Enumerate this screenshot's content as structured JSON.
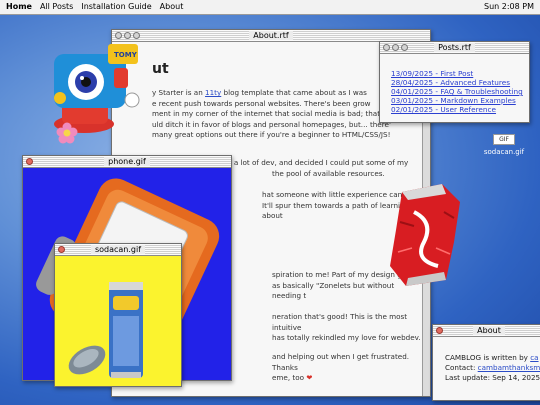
{
  "menubar": {
    "home": "Home",
    "items": [
      "All Posts",
      "Installation Guide",
      "About"
    ],
    "clock": "Sun 2:08 PM"
  },
  "about_window": {
    "title": "About.rtf",
    "heading": "ut",
    "p1_prefix": "y Starter is an ",
    "p1_link": "11ty",
    "p1_rest": " blog template that came about as I was",
    "p1_l2": "e recent push towards personal websites. There's been grow",
    "p1_l3": "ment in my corner of the internet that social media is bad; that t",
    "p1_l4": "uld ditch it in favor of blogs and personal homepages, but... there'",
    "p1_l5": "many great options out there if you're a beginner to HTML/CSS/JS!",
    "p2_l1": "Lately I've been doing a lot of dev, and decided I could put some of my",
    "p2_l2": "the pool of available resources.",
    "p3_l1": "hat someone with little experience can",
    "p3_l2": "It'll spur them towards a path of learning about",
    "p4_l1": "spiration to me! Part of my design goal fo",
    "p4_l2": "as basically \"Zonelets but without needing t",
    "p5_l1": "neration that's good! This is the most intuitive",
    "p5_l2": "has totally rekindled my love for webdev.",
    "p6_l1": "and helping out when I get frustrated. Thanks",
    "p6_l2": "eme, too",
    "heart": "❤"
  },
  "posts_window": {
    "title": "Posts.rtf",
    "posts": [
      "13/09/2025 - First Post",
      "28/04/2025 - Advanced Features",
      "04/01/2025 - FAQ & Troubleshooting",
      "03/01/2025 - Markdown Examples",
      "02/01/2025 - User Reference"
    ]
  },
  "phone_window": {
    "title": "phone.gif"
  },
  "sodacan_window": {
    "title": "sodacan.gif"
  },
  "about_small": {
    "title": "About",
    "line1_prefix": "CAMBLOG is written by ",
    "line1_link": "ca",
    "line2_prefix": "Contact: ",
    "line2_link": "cambamthanksm",
    "line3": "Last update: Sep 14, 2025"
  },
  "desktop_icon": {
    "badge": "GIF",
    "label": "sodacan.gif"
  },
  "toy_label": "TOMY",
  "colors": {
    "desktop": "#2f63c2",
    "phone_bg": "#2222e8",
    "sodacan_bg": "#fbf32e",
    "link": "#2b4cc7",
    "close_button": "#e26a5f"
  }
}
